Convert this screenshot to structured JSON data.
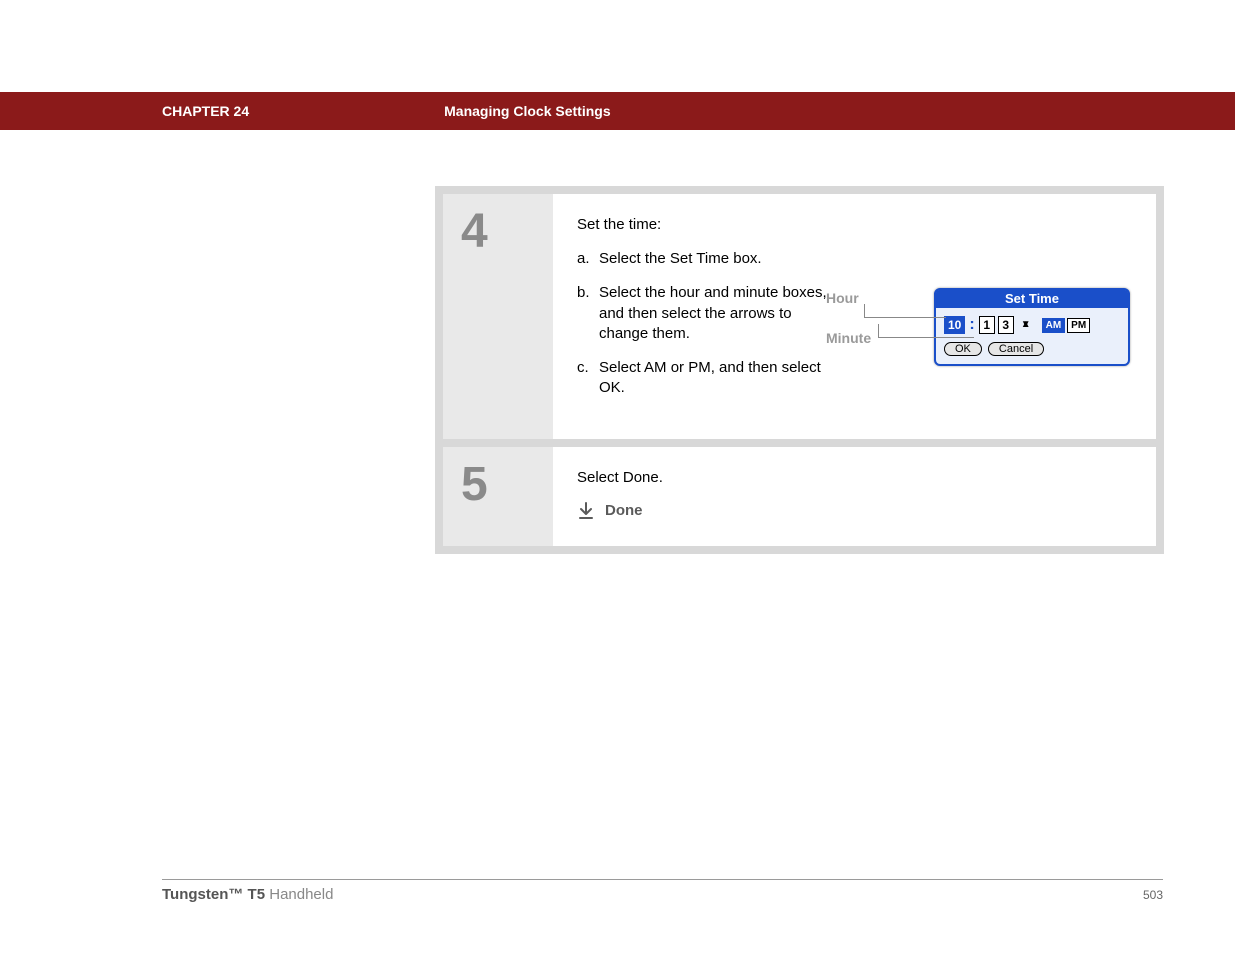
{
  "header": {
    "chapter": "CHAPTER 24",
    "title": "Managing Clock Settings"
  },
  "steps": {
    "s4": {
      "num": "4",
      "title": "Set the time:",
      "items": [
        {
          "marker": "a.",
          "text": "Select the Set Time box."
        },
        {
          "marker": "b.",
          "text": "Select the hour and minute boxes, and then select the arrows to change them."
        },
        {
          "marker": "c.",
          "text": "Select AM or PM, and then select OK."
        }
      ],
      "labels": {
        "hour": "Hour",
        "minute": "Minute"
      },
      "dialog": {
        "title": "Set Time",
        "hour": "10",
        "min_tens": "1",
        "min_ones": "3",
        "am": "AM",
        "pm": "PM",
        "ok": "OK",
        "cancel": "Cancel"
      }
    },
    "s5": {
      "num": "5",
      "title": "Select Done.",
      "done_label": "Done"
    }
  },
  "footer": {
    "product_bold": "Tungsten™ T5",
    "product_light": " Handheld",
    "page": "503"
  }
}
